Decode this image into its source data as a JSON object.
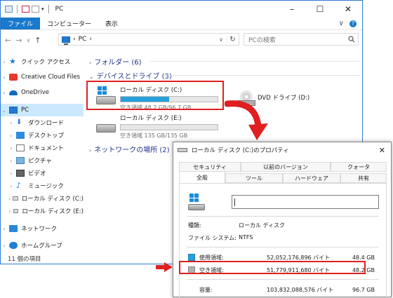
{
  "explorer": {
    "title": "PC",
    "win_min": "–",
    "win_max": "☐",
    "win_close": "✕",
    "ribbon_tabs": [
      "ファイル",
      "コンピューター",
      "表示"
    ],
    "ribbon_expand": "∨",
    "help": "?",
    "nav_back": "←",
    "nav_forward": "→",
    "nav_recent": "∨",
    "nav_up": "↑",
    "address_sep": "›",
    "address_segment": "PC",
    "address_end_sep": "›",
    "address_dropdown": "∨",
    "refresh": "↻",
    "search_placeholder": "PCの検索",
    "search_icon": "search-icon",
    "sidebar": {
      "quick_access": "クイック アクセス",
      "creative_cloud": "Creative Cloud Files",
      "onedrive": "OneDrive",
      "pc": "PC",
      "downloads": "ダウンロード",
      "desktop": "デスクトップ",
      "documents": "ドキュメント",
      "pictures": "ピクチャ",
      "videos": "ビデオ",
      "music": "ミュージック",
      "local_c": "ローカル ディスク (C:)",
      "local_e": "ローカル ディスク (E:)",
      "network": "ネットワーク",
      "homegroup": "ホームグループ"
    },
    "groups": {
      "folders": "フォルダー (6)",
      "devices": "デバイスとドライブ (3)",
      "network": "ネットワークの場所 (2)"
    },
    "drives": [
      {
        "name": "ローカル ディスク (C:)",
        "info": "空き領域 48.2 GB/96.7 GB",
        "used_fraction": 0.5
      },
      {
        "name": "ローカル ディスク (E:)",
        "info": "空き領域 135 GB/135 GB",
        "used_fraction": 0.0
      }
    ],
    "dvd_name": "DVD ドライブ (D:)",
    "status": "11 個の項目"
  },
  "dialog": {
    "title": "ローカル ディスク (C:)のプロパティ",
    "close": "✕",
    "tabs_top": [
      "セキュリティ",
      "以前のバージョン",
      "クォータ"
    ],
    "tabs_bottom": [
      "全般",
      "ツール",
      "ハードウェア",
      "共有"
    ],
    "type_label": "種類:",
    "type_value": "ローカル ディスク",
    "fs_label": "ファイル システム:",
    "fs_value": "NTFS",
    "used_label": "使用領域:",
    "used_bytes": "52,052,176,896 バイト",
    "used_gb": "48.4 GB",
    "free_label": "空き領域:",
    "free_bytes": "51,779,911,680 バイト",
    "free_gb": "48.2 GB",
    "cap_label": "容量:",
    "cap_bytes": "103,832,088,576 バイト",
    "cap_gb": "96.7 GB"
  },
  "colors": {
    "accent": "#1979ca",
    "highlight": "#e02020",
    "used_color": "#26a0da",
    "free_color": "#b0b0b0"
  }
}
